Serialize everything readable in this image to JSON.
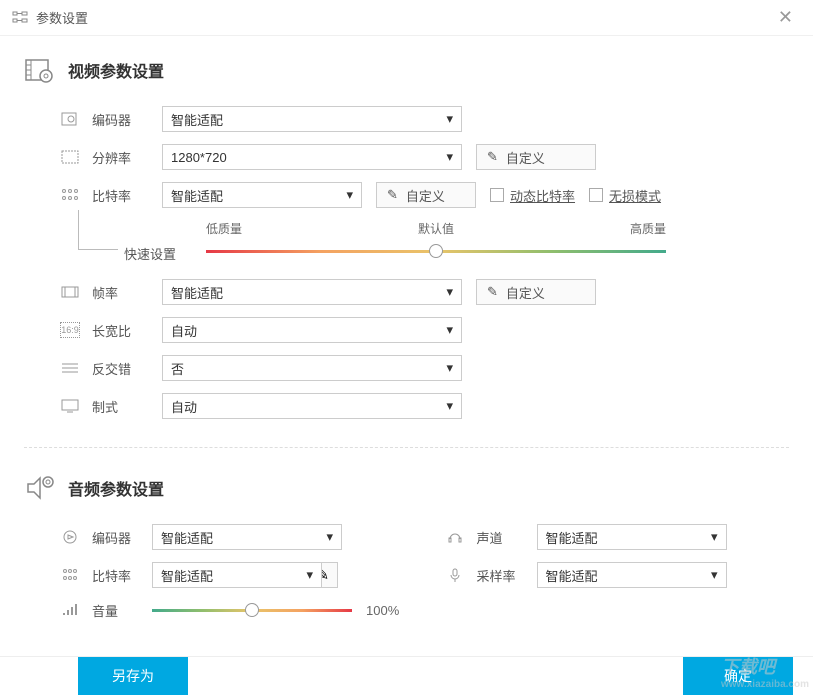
{
  "window": {
    "title": "参数设置"
  },
  "video": {
    "section_title": "视频参数设置",
    "encoder": {
      "label": "编码器",
      "value": "智能适配"
    },
    "resolution": {
      "label": "分辨率",
      "value": "1280*720",
      "custom_btn": "自定义"
    },
    "bitrate": {
      "label": "比特率",
      "value": "智能适配",
      "custom_btn": "自定义",
      "dynamic_label": "动态比特率",
      "lossless_label": "无损模式"
    },
    "quick": {
      "label": "快速设置",
      "low": "低质量",
      "default": "默认值",
      "high": "高质量"
    },
    "framerate": {
      "label": "帧率",
      "value": "智能适配",
      "custom_btn": "自定义"
    },
    "aspect": {
      "label": "长宽比",
      "value": "自动",
      "badge": "16:9"
    },
    "deinterlace": {
      "label": "反交错",
      "value": "否"
    },
    "standard": {
      "label": "制式",
      "value": "自动"
    }
  },
  "audio": {
    "section_title": "音频参数设置",
    "encoder": {
      "label": "编码器",
      "value": "智能适配"
    },
    "channel": {
      "label": "声道",
      "value": "智能适配"
    },
    "bitrate": {
      "label": "比特率",
      "value": "智能适配"
    },
    "samplerate": {
      "label": "采样率",
      "value": "智能适配"
    },
    "volume": {
      "label": "音量",
      "value": "100%"
    }
  },
  "footer": {
    "save_as": "另存为",
    "ok": "确定"
  },
  "watermark": {
    "main": "下载吧",
    "sub": "www.xiazaiba.com"
  }
}
